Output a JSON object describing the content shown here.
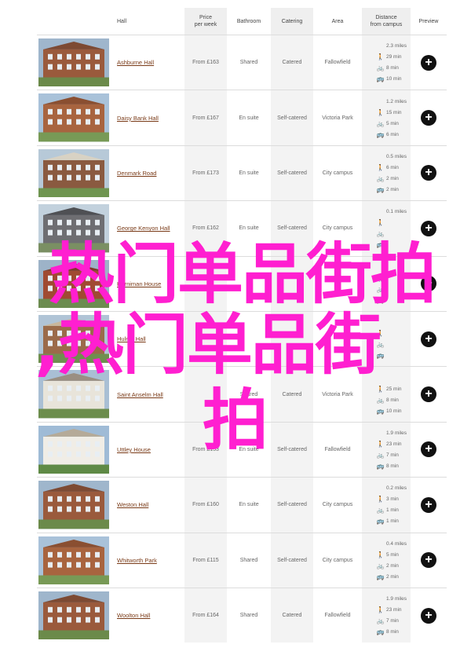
{
  "header": {
    "hall": "Hall",
    "price": "Price\nper week",
    "bathroom": "Bathroom",
    "catering": "Catering",
    "area": "Area",
    "distance": "Distance\nfrom campus",
    "preview": "Preview"
  },
  "rows": [
    {
      "name": "Ashburne Hall",
      "price": "From £163",
      "bathroom": "Shared",
      "catering": "Catered",
      "area": "Fallowfield",
      "miles": "2.3 miles",
      "walk": "29 min",
      "bike": "8 min",
      "bus": "10 min",
      "photo": "brick-terrace"
    },
    {
      "name": "Daisy Bank Hall",
      "price": "From £167",
      "bathroom": "En suite",
      "catering": "Self-catered",
      "area": "Victoria Park",
      "miles": "1.2 miles",
      "walk": "15 min",
      "bike": "5 min",
      "bus": "6 min",
      "photo": "brick-block"
    },
    {
      "name": "Denmark Road",
      "price": "From £173",
      "bathroom": "En suite",
      "catering": "Self-catered",
      "area": "City campus",
      "miles": "0.5 miles",
      "walk": "6 min",
      "bike": "2 min",
      "bus": "2 min",
      "photo": "modern-block"
    },
    {
      "name": "George Kenyon Hall",
      "price": "From £162",
      "bathroom": "En suite",
      "catering": "Self-catered",
      "area": "City campus",
      "miles": "0.1 miles",
      "walk": "",
      "bike": "",
      "bus": "",
      "photo": "tower"
    },
    {
      "name": "Horniman House",
      "price": "",
      "bathroom": "",
      "catering": "",
      "area": "",
      "miles": "",
      "walk": "",
      "bike": "",
      "bus": "",
      "photo": "red-block"
    },
    {
      "name": "Hulme Hall",
      "price": "",
      "bathroom": "",
      "catering": "",
      "area": "",
      "miles": "",
      "walk": "",
      "bike": "",
      "bus": "",
      "photo": "house"
    },
    {
      "name": "Saint Anselm Hall",
      "price": "",
      "bathroom": "Shared",
      "catering": "Catered",
      "area": "Victoria Park",
      "miles": "",
      "walk": "25 min",
      "bike": "8 min",
      "bus": "10 min",
      "photo": "white-house"
    },
    {
      "name": "Uttley House",
      "price": "From £153",
      "bathroom": "En suite",
      "catering": "Self-catered",
      "area": "Fallowfield",
      "miles": "1.9 miles",
      "walk": "23 min",
      "bike": "7 min",
      "bus": "8 min",
      "photo": "white-villa"
    },
    {
      "name": "Weston Hall",
      "price": "From £160",
      "bathroom": "En suite",
      "catering": "Self-catered",
      "area": "City campus",
      "miles": "0.2 miles",
      "walk": "3 min",
      "bike": "1 min",
      "bus": "1 min",
      "photo": "brick-terrace"
    },
    {
      "name": "Whitworth Park",
      "price": "From £115",
      "bathroom": "Shared",
      "catering": "Self-catered",
      "area": "City campus",
      "miles": "0.4 miles",
      "walk": "5 min",
      "bike": "2 min",
      "bus": "2 min",
      "photo": "brick-block"
    },
    {
      "name": "Woolton Hall",
      "price": "From £164",
      "bathroom": "Shared",
      "catering": "Catered",
      "area": "Fallowfield",
      "miles": "1.9 miles",
      "walk": "23 min",
      "bike": "7 min",
      "bus": "8 min",
      "photo": "brick-terrace"
    }
  ],
  "overlay": {
    "line1": "热门单品街拍",
    "line2": ",热门单品街",
    "line3": "拍"
  },
  "colors": {
    "overlay": "#ff1fd0",
    "link": "#7a3b18",
    "preview_button": "#111111"
  },
  "icons": {
    "walk": "walking-person-icon",
    "bike": "bicycle-icon",
    "bus": "bus-icon",
    "preview": "plus-circle-icon"
  }
}
